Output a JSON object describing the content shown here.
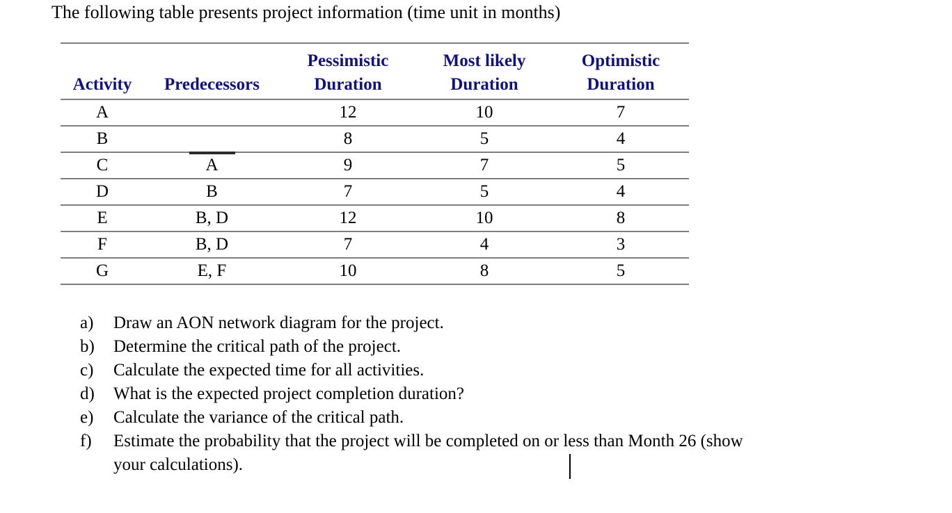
{
  "document": {
    "intro": "The following table presents project information (time unit in months)",
    "text_color": "#000000",
    "header_color": "#111180",
    "rule_color": "#7d7d7d"
  },
  "table": {
    "columns": [
      {
        "key": "activity",
        "header_line1": "",
        "header_line2": "Activity"
      },
      {
        "key": "predecessors",
        "header_line1": "",
        "header_line2": "Predecessors"
      },
      {
        "key": "pessimistic",
        "header_line1": "Pessimistic",
        "header_line2": "Duration"
      },
      {
        "key": "most_likely",
        "header_line1": "Most likely",
        "header_line2": "Duration"
      },
      {
        "key": "optimistic",
        "header_line1": "Optimistic",
        "header_line2": "Duration"
      }
    ],
    "rows": [
      {
        "activity": "A",
        "predecessors": "",
        "pessimistic": "12",
        "most_likely": "10",
        "optimistic": "7"
      },
      {
        "activity": "B",
        "predecessors": "",
        "pessimistic": "8",
        "most_likely": "5",
        "optimistic": "4"
      },
      {
        "activity": "C",
        "predecessors": "A",
        "pessimistic": "9",
        "most_likely": "7",
        "optimistic": "5"
      },
      {
        "activity": "D",
        "predecessors": "B",
        "pessimistic": "7",
        "most_likely": "5",
        "optimistic": "4"
      },
      {
        "activity": "E",
        "predecessors": "B, D",
        "pessimistic": "12",
        "most_likely": "10",
        "optimistic": "8"
      },
      {
        "activity": "F",
        "predecessors": "B, D",
        "pessimistic": "7",
        "most_likely": "4",
        "optimistic": "3"
      },
      {
        "activity": "G",
        "predecessors": "E, F",
        "pessimistic": "10",
        "most_likely": "8",
        "optimistic": "5"
      }
    ]
  },
  "questions": [
    {
      "marker": "a)",
      "text": "Draw an AON network diagram for the project.",
      "continuation": ""
    },
    {
      "marker": "b)",
      "text": "Determine the critical path of the project.",
      "continuation": ""
    },
    {
      "marker": "c)",
      "text": "Calculate the expected time for all activities.",
      "continuation": ""
    },
    {
      "marker": "d)",
      "text": "What is the expected project completion duration?",
      "continuation": ""
    },
    {
      "marker": "e)",
      "text": "Calculate the variance of the critical path.",
      "continuation": ""
    },
    {
      "marker": "f)",
      "text": "Estimate the probability that the project will be completed on or less than Month 26 (show",
      "continuation": "your calculations)."
    }
  ]
}
